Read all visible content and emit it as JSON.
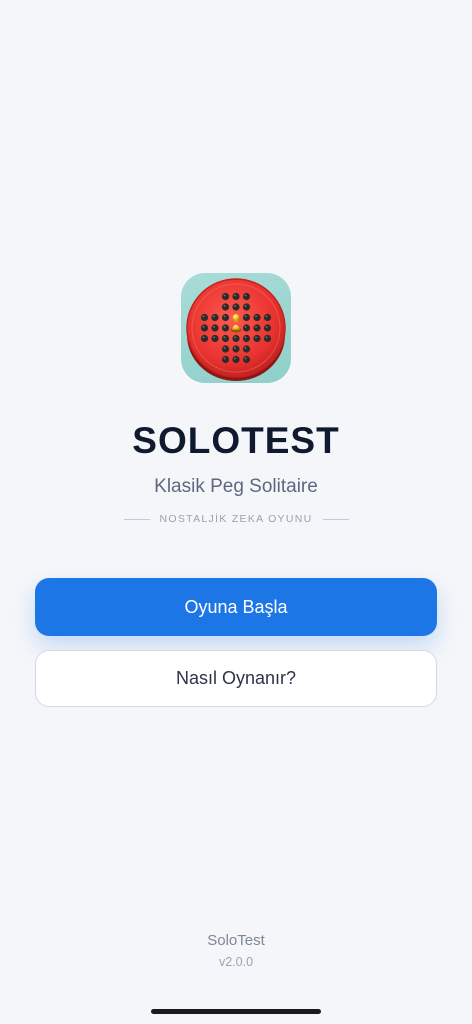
{
  "app": {
    "icon": "peg-solitaire-board-icon",
    "title": "SOLOTEST",
    "subtitle": "Klasik Peg Solitaire",
    "tagline": "NOSTALJİK ZEKA OYUNU"
  },
  "actions": {
    "start_label": "Oyuna Başla",
    "how_to_label": "Nasıl Oynanır?"
  },
  "footer": {
    "app_name": "SoloTest",
    "version": "v2.0.0"
  },
  "colors": {
    "background": "#f4f6f9",
    "primary": "#1d76e6",
    "title": "#101a2e",
    "icon_background": "#8fcfc9",
    "board_red": "#e8322f"
  }
}
